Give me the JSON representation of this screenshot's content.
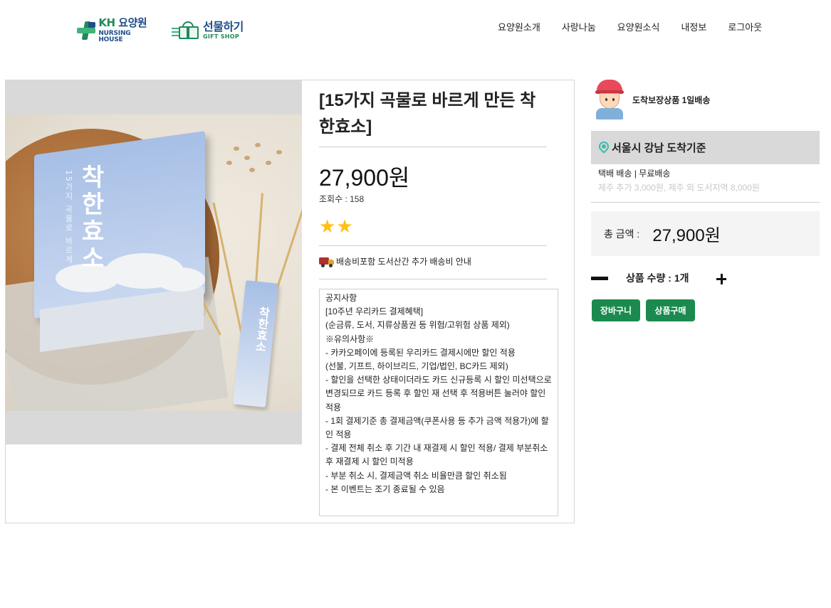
{
  "header": {
    "logo_kh": {
      "title_prefix": "KH",
      "title": "요양원",
      "subtitle": "NURSING HOUSE"
    },
    "logo_gift": {
      "title": "선물하기",
      "subtitle": "GIFT SHOP"
    },
    "nav": [
      {
        "label": "요양원소개"
      },
      {
        "label": "사랑나눔"
      },
      {
        "label": "요양원소식"
      },
      {
        "label": "내정보"
      },
      {
        "label": "로그아웃"
      }
    ]
  },
  "product": {
    "image": {
      "box_title": "착한효소",
      "box_subtitle": "15가지 곡물로 바르게 만든",
      "stick_title": "착한효소"
    },
    "title": "[15가지 곡물로 바르게 만든 착한효소]",
    "price": "27,900원",
    "views": "조회수 : 158",
    "rating": 2,
    "shipping_notice": "배송비포함 도서산간 추가 배송비 안내",
    "notice_lines": [
      "공지사항",
      "[10주년 우리카드 결제혜택]",
      "(순금류, 도서, 지류상품권 등 위험/고위험 상품 제외)",
      "※유의사항※",
      "- 카카오페이에 등록된 우리카드 결제시에만 할인 적용",
      "(선불, 기프트, 하이브리드, 기업/법인, BC카드 제외)",
      "- 할인을 선택한 상태이더라도 카드 신규등록 시 할인 미선택으로 변경되므로 카드 등록 후 할인 재 선택 후 적용버튼 눌러야 할인 적용",
      "- 1회 결제기준 총 결제금액(쿠폰사용 등 추가 금액 적용가)에 할인 적용",
      "- 결제 전체 취소 후 기간 내 재결제 시 할인 적용/ 결제 부분취소 후 재결제 시 할인 미적용",
      "- 부분 취소 시, 결제금액 취소 비율만큼 할인 취소됨",
      "- 본 이벤트는 조기 종료될 수 있음"
    ]
  },
  "order": {
    "delivery_badge": "도착보장상품 1일배송",
    "location": "서울시 강남 도착기준",
    "shipping_type": "택배 배송 | 무료배송",
    "shipping_extra": "제주 추가 3,000원, 제주 외 도서지역 8,000원",
    "total_label": "총 금액 :",
    "total_value": "27,900원",
    "quantity_label": "상품 수량 : 1개",
    "quantity": 1,
    "cart_button": "장바구니",
    "buy_button": "상품구매"
  },
  "colors": {
    "brand_green": "#1a8a4e",
    "brand_blue": "#1d4e89",
    "star": "#ffbf16",
    "pin": "#3bbcae"
  },
  "icons": [
    "plus-cross-logo-icon",
    "gift-box-icon",
    "star-icon",
    "truck-icon",
    "courier-avatar-icon",
    "location-pin-icon",
    "minus-icon",
    "plus-icon"
  ]
}
